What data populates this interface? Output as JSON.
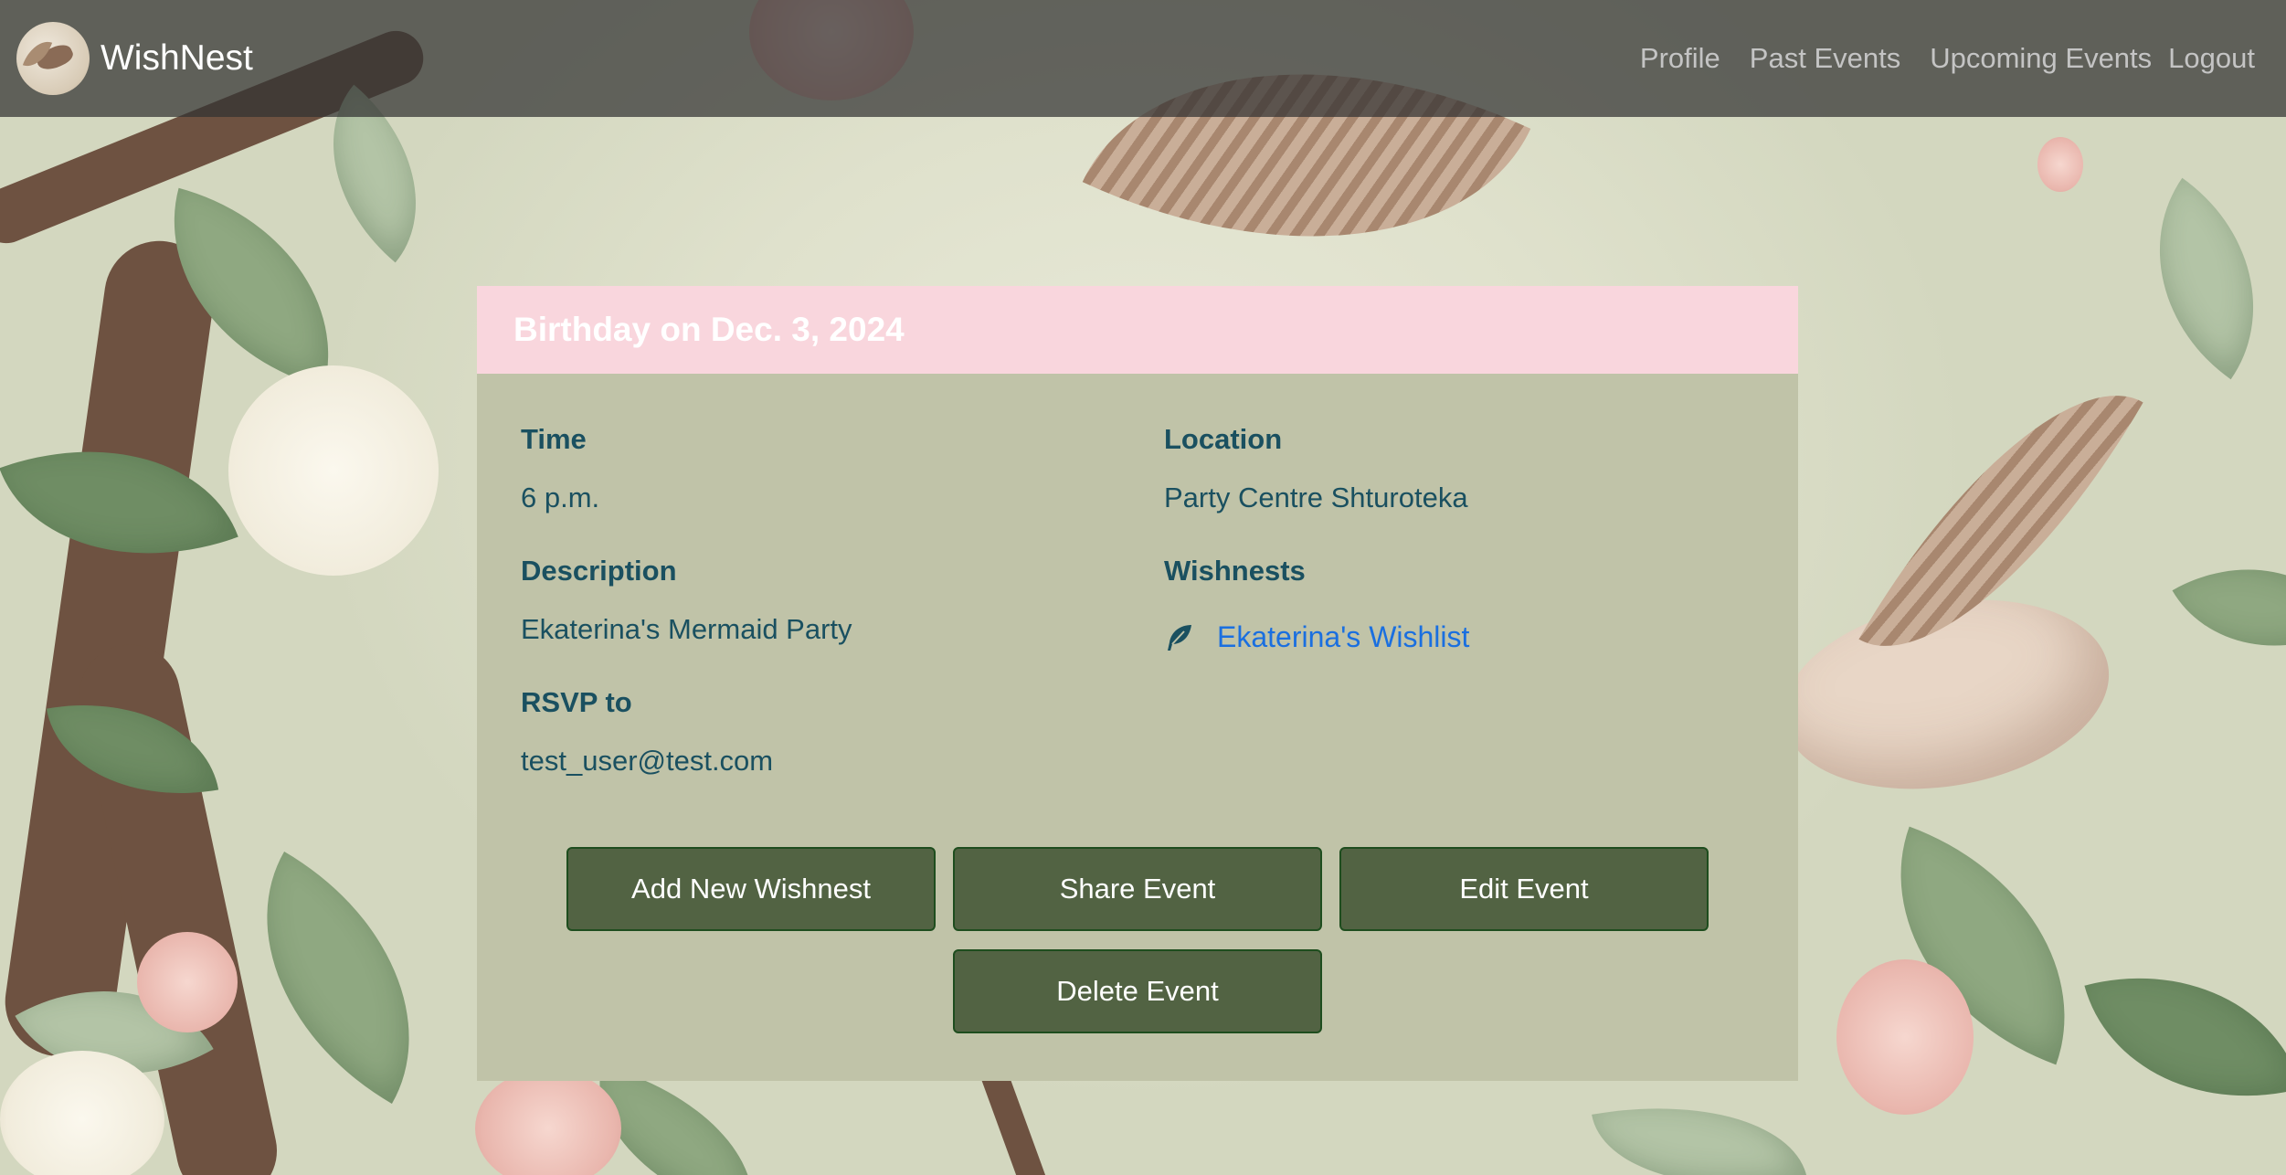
{
  "nav": {
    "brand": "WishNest",
    "links": [
      "Profile",
      "Past Events",
      "Upcoming Events",
      "Logout"
    ]
  },
  "event": {
    "title": "Birthday on Dec. 3, 2024",
    "time_label": "Time",
    "time": "6 p.m.",
    "location_label": "Location",
    "location": "Party Centre Shturoteka",
    "description_label": "Description",
    "description": "Ekaterina's Mermaid Party",
    "wishnests_label": "Wishnests",
    "wishnests": [
      "Ekaterina's Wishlist"
    ],
    "rsvp_label": "RSVP to",
    "rsvp": "test_user@test.com"
  },
  "actions": {
    "add_wishnest": "Add New Wishnest",
    "share": "Share Event",
    "edit": "Edit Event",
    "delete": "Delete Event"
  },
  "colors": {
    "navbar": "#323232",
    "card_header": "#f9d6dd",
    "card_body": "#c0c3a8",
    "label_text": "#1a5060",
    "link": "#1a6fe0",
    "button": "#526343"
  },
  "icons": {
    "wishnest_item": "feather-icon",
    "logo": "bird-logo"
  }
}
